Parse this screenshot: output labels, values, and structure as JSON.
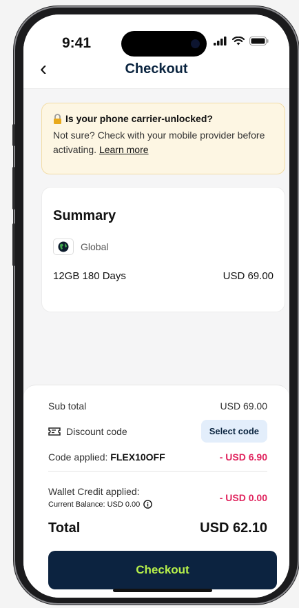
{
  "status_bar": {
    "time": "9:41"
  },
  "header": {
    "title": "Checkout",
    "back_icon": "chevron-left-icon"
  },
  "alert": {
    "title": "Is your phone carrier-unlocked?",
    "body": "Not sure? Check with your mobile provider before activating.",
    "link": "Learn more",
    "icon": "lock-icon"
  },
  "summary": {
    "title": "Summary",
    "region": "Global",
    "plan": "12GB 180 Days",
    "price": "USD 69.00"
  },
  "checkout": {
    "subtotal_label": "Sub total",
    "subtotal_value": "USD 69.00",
    "discount_label": "Discount code",
    "discount_button": "Select code",
    "code_applied_prefix": "Code applied: ",
    "code_applied_code": "FLEX10OFF",
    "code_applied_value": "- USD 6.90",
    "wallet_label": "Wallet Credit applied:",
    "wallet_balance": "Current Balance: USD 0.00",
    "wallet_value": "- USD 0.00",
    "total_label": "Total",
    "total_value": "USD 62.10",
    "checkout_button": "Checkout"
  },
  "colors": {
    "accent": "#0c2340",
    "button_text": "#b6f04a",
    "negative": "#e0245e",
    "alert_bg": "#fdf6e3"
  }
}
